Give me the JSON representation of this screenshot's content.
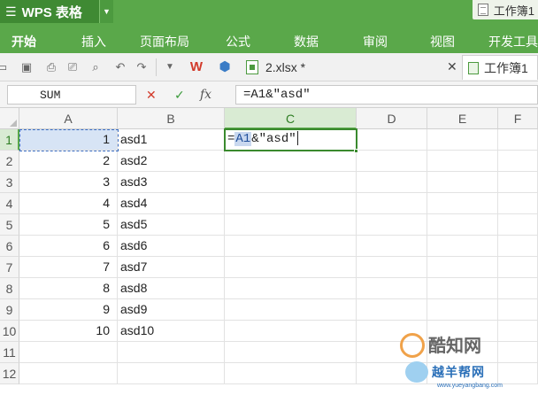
{
  "app": {
    "name": "WPS 表格",
    "window_title": "工作簿1"
  },
  "ribbon_tabs": [
    "开始",
    "插入",
    "页面布局",
    "公式",
    "数据",
    "审阅",
    "视图",
    "开发工具"
  ],
  "document_tabs": {
    "file": "2.xlsx *",
    "active": "工作簿1"
  },
  "formula_bar": {
    "name_box": "SUM",
    "formula": "=A1&\"asd\""
  },
  "columns": [
    "A",
    "B",
    "C",
    "D",
    "E",
    "F"
  ],
  "rows": [
    "1",
    "2",
    "3",
    "4",
    "5",
    "6",
    "7",
    "8",
    "9",
    "10",
    "11",
    "12"
  ],
  "cells": {
    "A": [
      "1",
      "2",
      "3",
      "4",
      "5",
      "6",
      "7",
      "8",
      "9",
      "10"
    ],
    "B": [
      "asd1",
      "asd2",
      "asd3",
      "asd4",
      "asd5",
      "asd6",
      "asd7",
      "asd8",
      "asd9",
      "asd10"
    ]
  },
  "editing_cell": {
    "prefix": "=",
    "ref": "A1",
    "suffix": "&\"asd\""
  },
  "watermark": {
    "brand": "酷知网",
    "sub": "越羊帮网",
    "url": "www.yueyangbang.com"
  },
  "colors": {
    "accent": "#5aa84a",
    "active_cell_border": "#3a8a2e",
    "reference_highlight": "#d7e4f5"
  }
}
